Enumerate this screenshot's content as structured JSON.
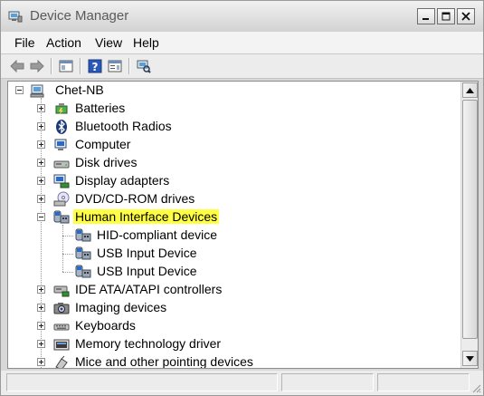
{
  "window": {
    "title": "Device Manager"
  },
  "menu": [
    "File",
    "Action",
    "View",
    "Help"
  ],
  "tree": {
    "root": "Chet-NB",
    "categories": [
      {
        "label": "Batteries",
        "icon": "battery-icon"
      },
      {
        "label": "Bluetooth Radios",
        "icon": "bluetooth-icon"
      },
      {
        "label": "Computer",
        "icon": "computer-icon"
      },
      {
        "label": "Disk drives",
        "icon": "disk-drive-icon"
      },
      {
        "label": "Display adapters",
        "icon": "display-adapter-icon"
      },
      {
        "label": "DVD/CD-ROM drives",
        "icon": "dvd-drive-icon"
      },
      {
        "label": "Human Interface Devices",
        "icon": "hid-icon",
        "expanded": true,
        "selected": true,
        "children": [
          "HID-compliant device",
          "USB Input Device",
          "USB Input Device"
        ]
      },
      {
        "label": "IDE ATA/ATAPI controllers",
        "icon": "ide-controller-icon"
      },
      {
        "label": "Imaging devices",
        "icon": "camera-icon"
      },
      {
        "label": "Keyboards",
        "icon": "keyboard-icon"
      },
      {
        "label": "Memory technology driver",
        "icon": "memory-icon"
      },
      {
        "label": "Mice and other pointing devices",
        "icon": "mouse-icon"
      }
    ]
  },
  "colors": {
    "selection": "#ffff44",
    "window_bg": "#d8d8d8"
  }
}
